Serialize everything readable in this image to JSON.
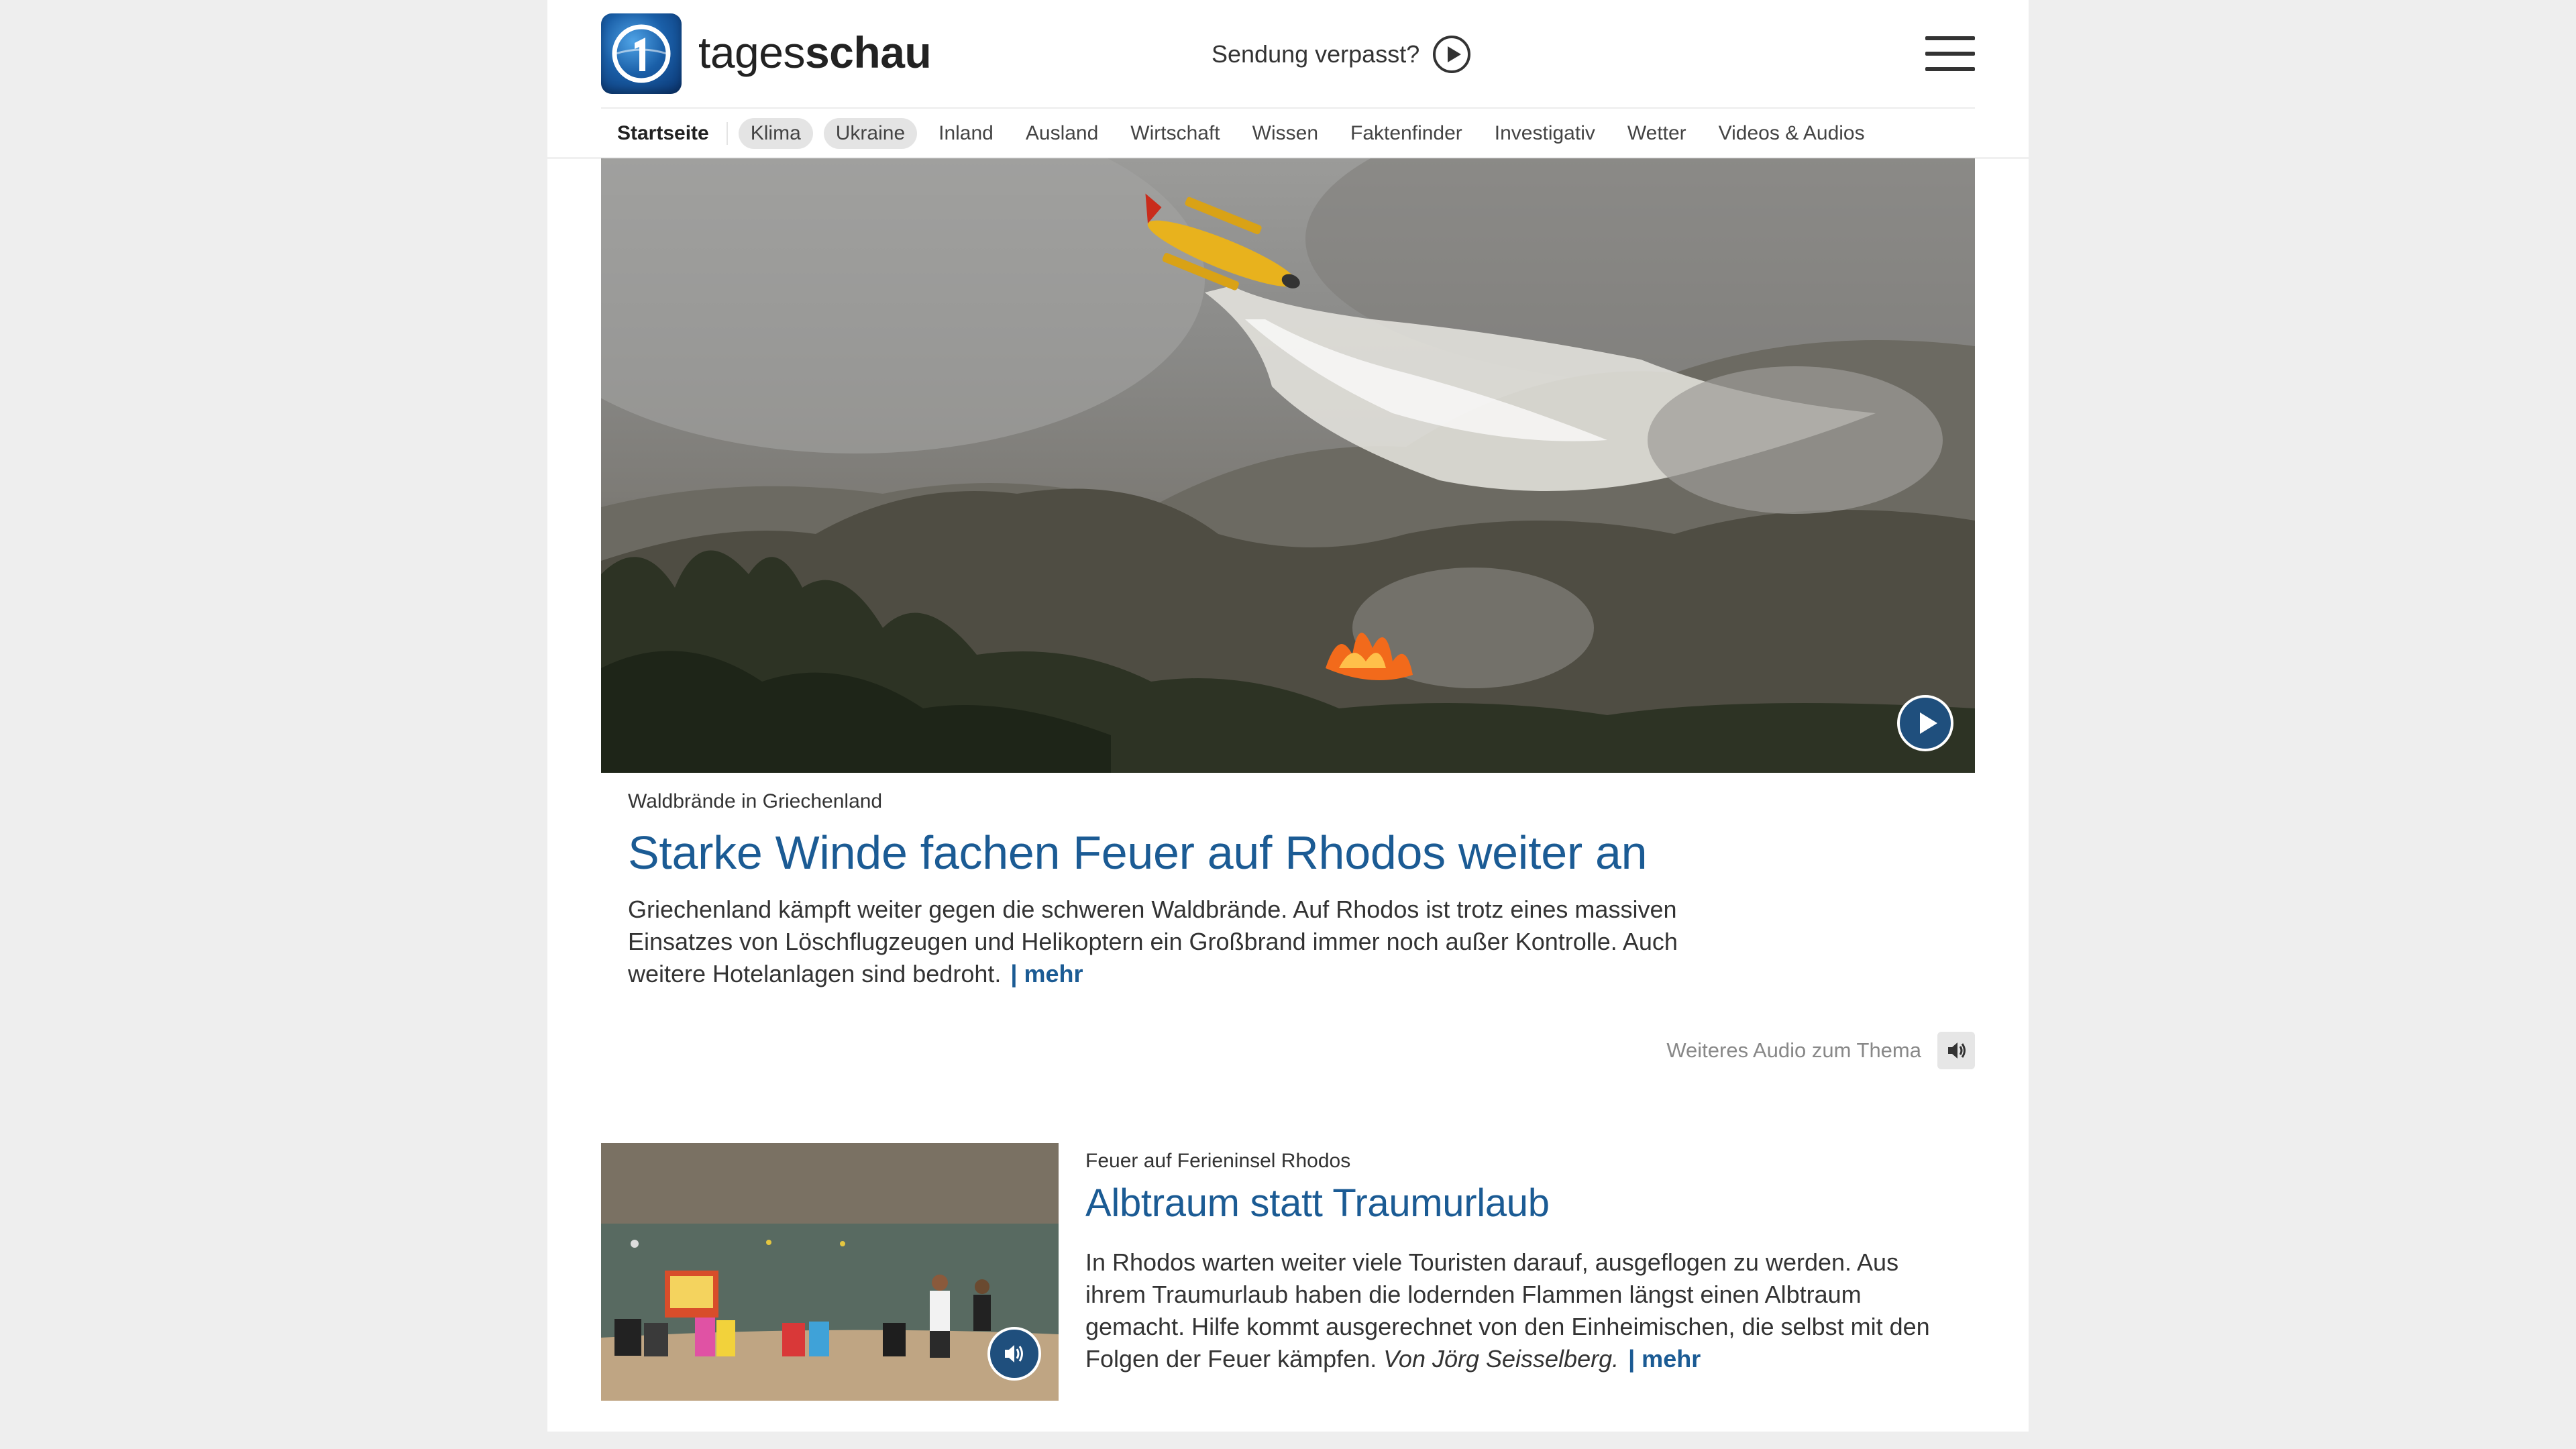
{
  "header": {
    "brand_light": "tages",
    "brand_bold": "schau",
    "missed_label": "Sendung verpasst?"
  },
  "nav": {
    "items": [
      {
        "label": "Startseite",
        "style": "active"
      },
      {
        "label": "Klima",
        "style": "pill"
      },
      {
        "label": "Ukraine",
        "style": "pill"
      },
      {
        "label": "Inland",
        "style": "plain"
      },
      {
        "label": "Ausland",
        "style": "plain"
      },
      {
        "label": "Wirtschaft",
        "style": "plain"
      },
      {
        "label": "Wissen",
        "style": "plain"
      },
      {
        "label": "Faktenfinder",
        "style": "plain"
      },
      {
        "label": "Investigativ",
        "style": "plain"
      },
      {
        "label": "Wetter",
        "style": "plain"
      },
      {
        "label": "Videos & Audios",
        "style": "plain"
      }
    ]
  },
  "hero": {
    "topline": "Waldbrände in Griechenland",
    "headline": "Starke Winde fachen Feuer auf Rhodos weiter an",
    "teaser_lines": [
      "Griechenland kämpft weiter gegen die schweren Waldbrände. Auf Rhodos ist trotz eines massiven",
      "Einsatzes von Löschflugzeugen und Helikoptern ein Großbrand immer noch außer Kontrolle. Auch",
      "weitere Hotelanlagen sind bedroht."
    ],
    "more_label": "| mehr",
    "media_icon": "play-icon"
  },
  "related_audio": {
    "label": "Weiteres Audio zum Thema",
    "icon": "speaker-icon"
  },
  "article2": {
    "topline": "Feuer auf Ferieninsel Rhodos",
    "headline": "Albtraum statt Traumurlaub",
    "teaser_lines": [
      "In Rhodos warten weiter viele Touristen darauf, ausgeflogen zu werden. Aus",
      "ihrem Traumurlaub haben die lodernden Flammen längst einen Albtraum",
      "gemacht. Hilfe kommt ausgerechnet von den Einheimischen, die selbst mit den"
    ],
    "last_line_text": "Folgen der Feuer kämpfen.",
    "author": "Von Jörg Seisselberg.",
    "more_label": "| mehr",
    "media_icon": "speaker-icon"
  },
  "colors": {
    "link_blue": "#1b5b94",
    "button_blue": "#1f4f7d",
    "pill_gray": "#e4e4e4",
    "page_bg": "#eeeeee"
  }
}
